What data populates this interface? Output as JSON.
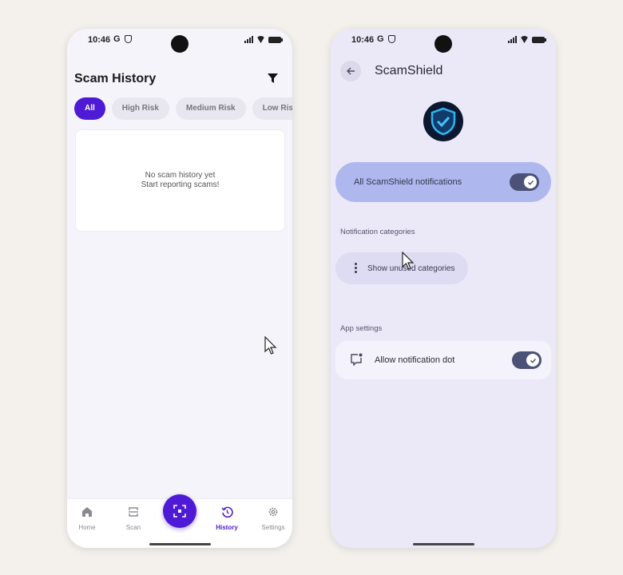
{
  "left_phone": {
    "status_bar": {
      "time": "10:46",
      "g_icon": "G"
    },
    "page_title": "Scam History",
    "filter_chips": [
      {
        "label": "All",
        "active": true
      },
      {
        "label": "High Risk",
        "active": false
      },
      {
        "label": "Medium Risk",
        "active": false
      },
      {
        "label": "Low Ris",
        "active": false
      }
    ],
    "empty_state": {
      "line1": "No scam history yet",
      "line2": "Start reporting scams!"
    },
    "bottom_nav": [
      {
        "label": "Home",
        "icon": "home-icon",
        "active": false
      },
      {
        "label": "Scan",
        "icon": "scan-icon",
        "active": false
      },
      {
        "label": "History",
        "icon": "history-icon",
        "active": true
      },
      {
        "label": "Settings",
        "icon": "gear-icon",
        "active": false
      }
    ],
    "fab_icon": "qr-scan-icon",
    "accent_color": "#4e1ad6"
  },
  "right_phone": {
    "status_bar": {
      "time": "10:46",
      "g_icon": "G"
    },
    "app_title": "ScamShield",
    "master_toggle": {
      "label": "All ScamShield notifications",
      "on": true
    },
    "notification_categories_label": "Notification categories",
    "show_unused_label": "Show unused categories",
    "app_settings_label": "App settings",
    "notification_dot": {
      "label": "Allow notification dot",
      "on": true
    },
    "toggle_color": "#4b5177",
    "highlight_color": "#afb8ee"
  }
}
